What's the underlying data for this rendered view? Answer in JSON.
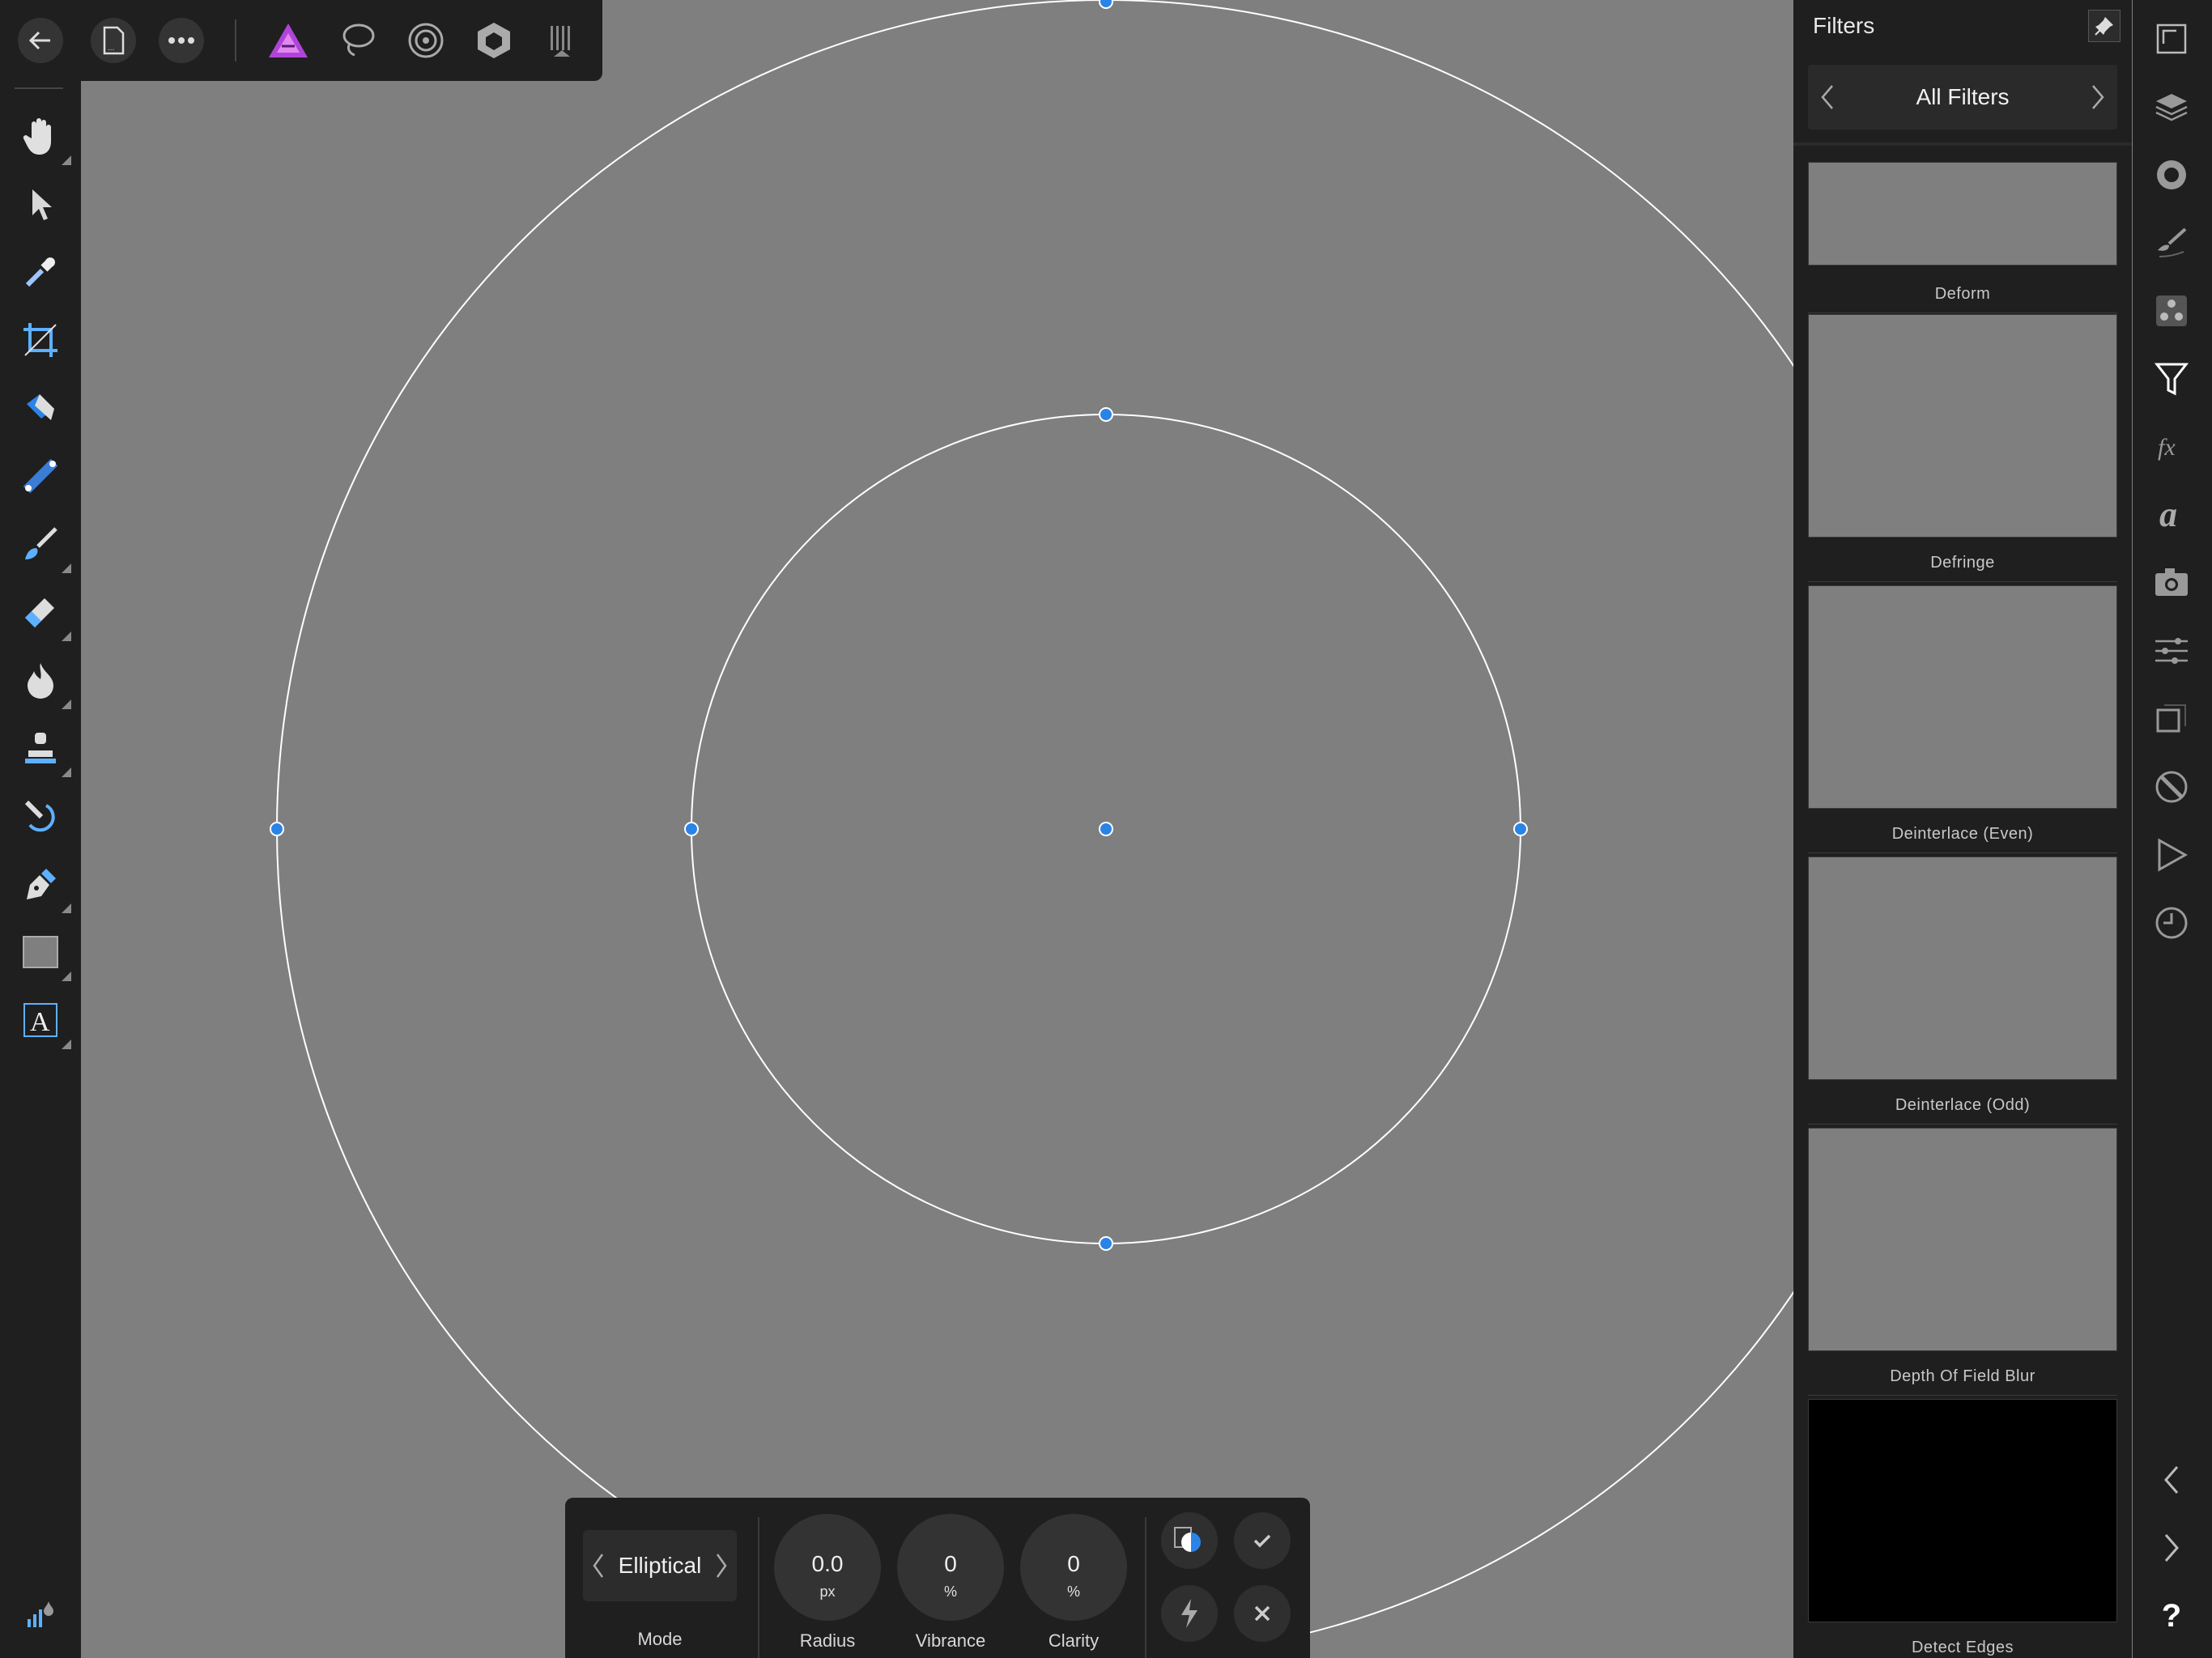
{
  "canvas": {
    "background": "#7f7f7f"
  },
  "topbar": {
    "icons": [
      "back-arrow-icon",
      "document-icon",
      "more-icon",
      "photo-persona-icon",
      "selection-persona-icon",
      "liquify-persona-icon",
      "develop-persona-icon",
      "tone-mapping-persona-icon"
    ]
  },
  "left_tools": [
    "hand-icon",
    "move-icon",
    "color-picker-icon",
    "crop-icon",
    "flood-fill-icon",
    "gradient-icon",
    "paint-brush-icon",
    "erase-brush-icon",
    "dodge-burn-icon",
    "clone-brush-icon",
    "red-eye-icon",
    "pen-icon",
    "rectangle-icon",
    "text-icon",
    "undo-history-icon"
  ],
  "panel": {
    "title": "Filters",
    "category": "All Filters",
    "filters": [
      {
        "name": "Deform",
        "thumb": "#7f7f7f"
      },
      {
        "name": "Defringe",
        "thumb": "#7f7f7f"
      },
      {
        "name": "Deinterlace (Even)",
        "thumb": "#7f7f7f"
      },
      {
        "name": "Deinterlace (Odd)",
        "thumb": "#7f7f7f"
      },
      {
        "name": "Depth Of Field Blur",
        "thumb": "#7f7f7f"
      },
      {
        "name": "Detect Edges",
        "thumb": "#000000"
      }
    ]
  },
  "studio_icons": [
    "navigator-icon",
    "layers-icon",
    "channels-icon",
    "brushes-icon",
    "swatches-icon",
    "filters-icon",
    "effects-icon",
    "text-styles-icon",
    "stock-icon",
    "adjustments-icon",
    "transform-icon",
    "history-icon",
    "macro-icon",
    "clock-icon",
    "collapse-left-icon",
    "expand-right-icon",
    "help-icon"
  ],
  "context": {
    "mode_value": "Elliptical",
    "mode_label": "Mode",
    "radius": {
      "value": "0.0",
      "unit": "px",
      "label": "Radius"
    },
    "vibrance": {
      "value": "0",
      "unit": "%",
      "label": "Vibrance"
    },
    "clarity": {
      "value": "0",
      "unit": "%",
      "label": "Clarity"
    }
  },
  "accent_color": "#2a84e8",
  "help_label": "?"
}
